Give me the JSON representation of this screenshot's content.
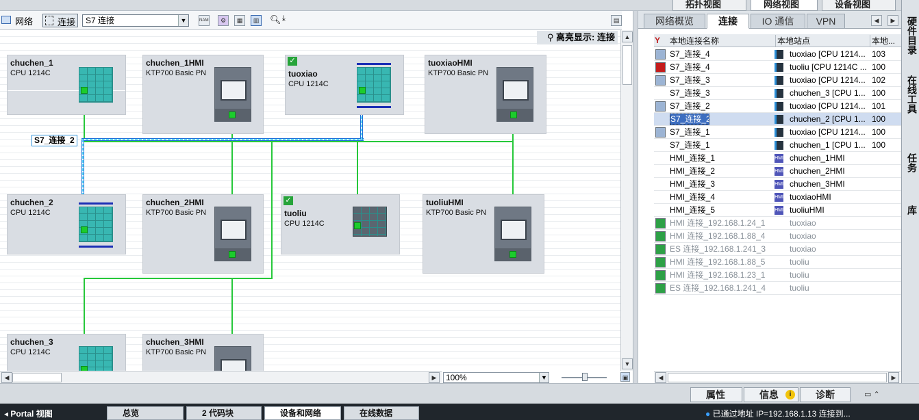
{
  "view_tabs": {
    "topology": "拓扑视图",
    "network": "网络视图",
    "device": "设备视图"
  },
  "toolbar": {
    "network_label": "网络",
    "connect_label": "连接",
    "connection_type": "S7 连接",
    "name_icon": "NAME"
  },
  "canvas": {
    "highlight_label": "高亮显示: 连接",
    "connection_bubble": "S7_连接_2",
    "devices": [
      {
        "name": "chuchen_1",
        "type": "CPU 1214C"
      },
      {
        "name": "chuchen_1HMI",
        "type": "KTP700 Basic PN"
      },
      {
        "name": "tuoxiao",
        "type": "CPU 1214C"
      },
      {
        "name": "tuoxiaoHMI",
        "type": "KTP700 Basic PN"
      },
      {
        "name": "chuchen_2",
        "type": "CPU 1214C"
      },
      {
        "name": "chuchen_2HMI",
        "type": "KTP700 Basic PN"
      },
      {
        "name": "tuoliu",
        "type": "CPU 1214C"
      },
      {
        "name": "tuoliuHMI",
        "type": "KTP700 Basic PN"
      },
      {
        "name": "chuchen_3",
        "type": "CPU 1214C"
      },
      {
        "name": "chuchen_3HMI",
        "type": "KTP700 Basic PN"
      }
    ],
    "zoom": "100%"
  },
  "right_panel": {
    "tabs": [
      "网络概览",
      "连接",
      "IO 通信",
      "VPN"
    ],
    "headers": {
      "local_name": "本地连接名称",
      "local_station": "本地站点",
      "local_id": "本地..."
    },
    "rows": [
      {
        "name": "S7_连接_4",
        "station": "tuoxiao [CPU 1214...",
        "id": "103"
      },
      {
        "name": "S7_连接_4",
        "station": "tuoliu [CPU 1214C ...",
        "id": "100"
      },
      {
        "name": "S7_连接_3",
        "station": "tuoxiao [CPU 1214...",
        "id": "102"
      },
      {
        "name": "S7_连接_3",
        "station": "chuchen_3 [CPU 1...",
        "id": "100"
      },
      {
        "name": "S7_连接_2",
        "station": "tuoxiao [CPU 1214...",
        "id": "101"
      },
      {
        "name": "S7_连接_2",
        "station": "chuchen_2 [CPU 1...",
        "id": "100"
      },
      {
        "name": "S7_连接_1",
        "station": "tuoxiao [CPU 1214...",
        "id": "100"
      },
      {
        "name": "S7_连接_1",
        "station": "chuchen_1 [CPU 1...",
        "id": "100"
      },
      {
        "name": "HMI_连接_1",
        "station": "chuchen_1HMI",
        "id": ""
      },
      {
        "name": "HMI_连接_2",
        "station": "chuchen_2HMI",
        "id": ""
      },
      {
        "name": "HMI_连接_3",
        "station": "chuchen_3HMI",
        "id": ""
      },
      {
        "name": "HMI_连接_4",
        "station": "tuoxiaoHMI",
        "id": ""
      },
      {
        "name": "HMI_连接_5",
        "station": "tuoliuHMI",
        "id": ""
      },
      {
        "name": "HMI 连接_192.168.1.24_1",
        "station": "tuoxiao",
        "id": ""
      },
      {
        "name": "HMI 连接_192.168.1.88_4",
        "station": "tuoxiao",
        "id": ""
      },
      {
        "name": "ES 连接_192.168.1.241_3",
        "station": "tuoxiao",
        "id": ""
      },
      {
        "name": "HMI 连接_192.168.1.88_5",
        "station": "tuoliu",
        "id": ""
      },
      {
        "name": "HMI 连接_192.168.1.23_1",
        "station": "tuoliu",
        "id": ""
      },
      {
        "name": "ES 连接_192.168.1.241_4",
        "station": "tuoliu",
        "id": ""
      }
    ]
  },
  "side_tabs": {
    "hardware": "硬件目录",
    "online_tools": "在线工具",
    "tasks": "任务",
    "library": "库"
  },
  "bottom_tabs": {
    "properties": "属性",
    "info": "信息",
    "diagnostics": "诊断"
  },
  "taskbar": {
    "portal": "Portal 视图",
    "overview": "总览",
    "code_blocks": "2 代码块",
    "devices_networks": "设备和网络",
    "online_data": "在线数据",
    "status": "已通过地址 IP=192.168.1.13 连接到..."
  },
  "colors": {
    "subnet": "#26c83a",
    "highlight": "#5fd6f5",
    "cpu": "#38b7b2",
    "selection": "#cfdcf0"
  }
}
